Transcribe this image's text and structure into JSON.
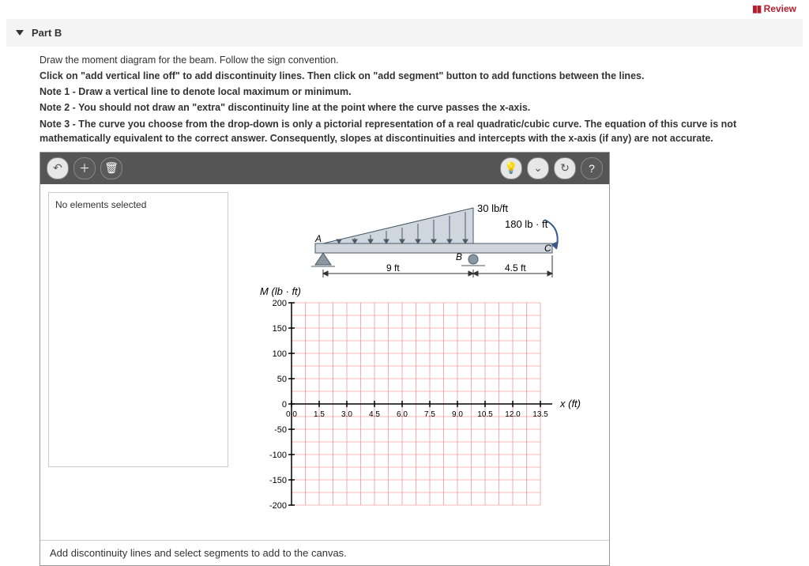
{
  "review_label": "Review",
  "part_title": "Part B",
  "instruction_lead": "Draw the moment diagram for the beam. Follow the sign convention.",
  "instr_click": "Click on \"add vertical line off\" to add discontinuity lines. Then click on \"add segment\" button to add functions between the lines.",
  "note1": "Note 1 - Draw a vertical line to denote local maximum or minimum.",
  "note2": "Note 2 - You should not draw an \"extra\" discontinuity line at the point where the curve passes the x-axis.",
  "note3": "Note 3 - The curve you choose from the drop-down is only a pictorial representation of a real quadratic/cubic curve. The equation of this curve is not mathematically equivalent to the correct answer. Consequently, slopes at discontinuities and intercepts with the x-axis (if any) are not accurate.",
  "side_panel_text": "No elements selected",
  "hint_text": "Add discontinuity lines and select segments to add to the canvas.",
  "beam": {
    "load_label": "30 lb/ft",
    "moment_label": "180 lb · ft",
    "A": "A",
    "B": "B",
    "C": "C",
    "span1": "9 ft",
    "span2": "4.5 ft"
  },
  "chart_data": {
    "type": "line",
    "title": "",
    "ylabel": "M (lb · ft)",
    "xlabel": "x (ft)",
    "ylim": [
      -200,
      200
    ],
    "xlim": [
      0,
      13.5
    ],
    "x_ticks": [
      "0.0",
      "1.5",
      "3.0",
      "4.5",
      "6.0",
      "7.5",
      "9.0",
      "10.5",
      "12.0",
      "13.5"
    ],
    "y_ticks": [
      "200",
      "150",
      "100",
      "50",
      "0",
      "-50",
      "-100",
      "-150",
      "-200"
    ],
    "series": []
  }
}
